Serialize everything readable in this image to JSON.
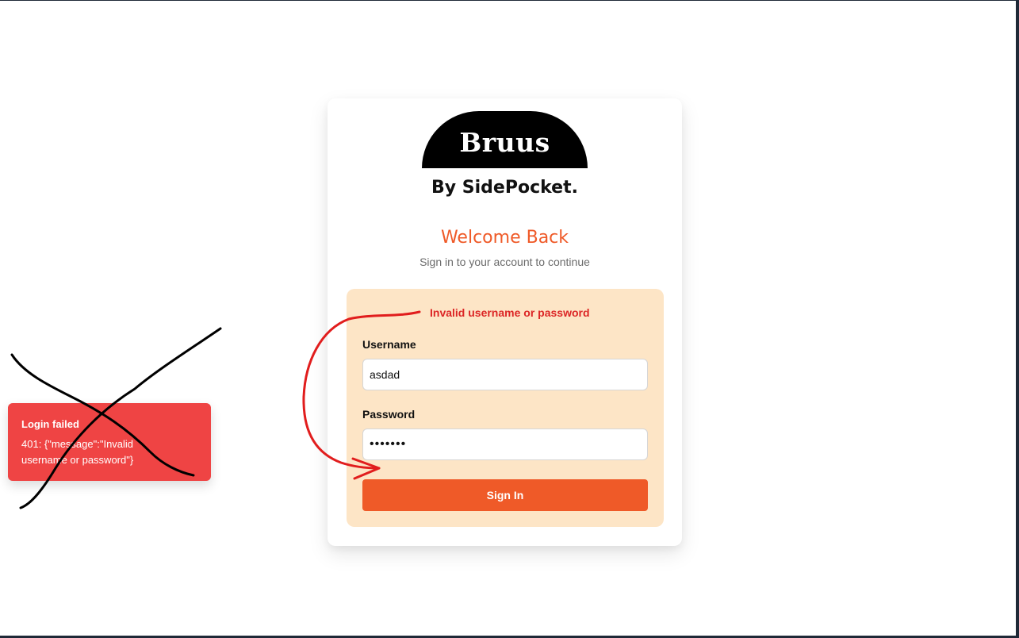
{
  "brand": {
    "logo_text": "Bruus",
    "tagline": "By SidePocket."
  },
  "heading": {
    "title": "Welcome Back",
    "subtitle": "Sign in to your account to continue"
  },
  "form": {
    "error_message": "Invalid username or password",
    "username_label": "Username",
    "username_value": "asdad",
    "password_label": "Password",
    "password_value": "•••••••",
    "submit_label": "Sign In"
  },
  "toast": {
    "title": "Login failed",
    "message": "401: {\"message\":\"Invalid username or password\"}"
  },
  "colors": {
    "accent": "#ef5a28",
    "panel": "#fde5c6",
    "error": "#dc2626",
    "toast_bg": "#ef4444"
  }
}
